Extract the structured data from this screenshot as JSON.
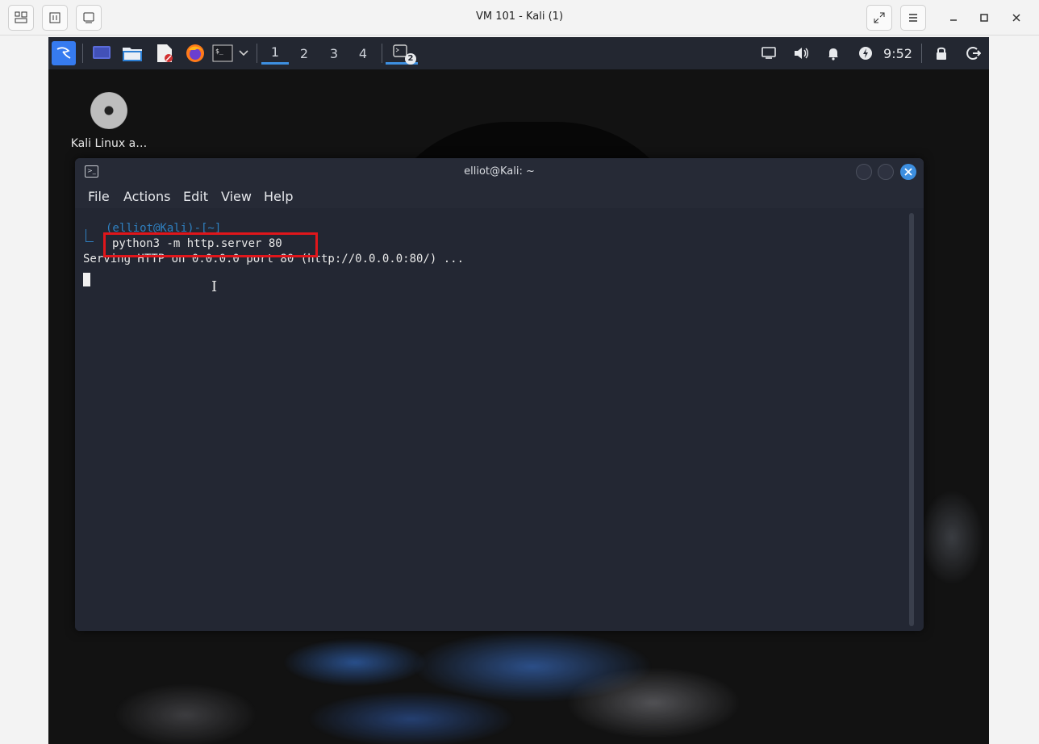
{
  "host": {
    "title": "VM 101 - Kali (1)",
    "left_buttons": [
      "layout-icon",
      "media-icon",
      "display-icon"
    ],
    "right_buttons": [
      "fullscreen-icon",
      "menu-icon"
    ],
    "window_controls": [
      "minimize-icon",
      "maximize-icon",
      "close-icon"
    ]
  },
  "panel": {
    "workspaces": [
      "1",
      "2",
      "3",
      "4"
    ],
    "active_workspace": "1",
    "task_badge": "2",
    "clock": "9:52",
    "colors": {
      "background": "#232731",
      "accent": "#3d8fe0"
    }
  },
  "desktop": {
    "icon_label": "Kali Linux a…"
  },
  "terminal": {
    "title": "elliot@Kali: ~",
    "menu": [
      "File",
      "Actions",
      "Edit",
      "View",
      "Help"
    ],
    "prompt": "(elliot@Kali)-[~]",
    "command": "python3 -m http.server 80",
    "output": "Serving HTTP on 0.0.0.0 port 80 (http://0.0.0.0:80/) ...",
    "colors": {
      "background": "#232733",
      "close": "#3d8fe0",
      "highlight": "#e0161b"
    }
  }
}
